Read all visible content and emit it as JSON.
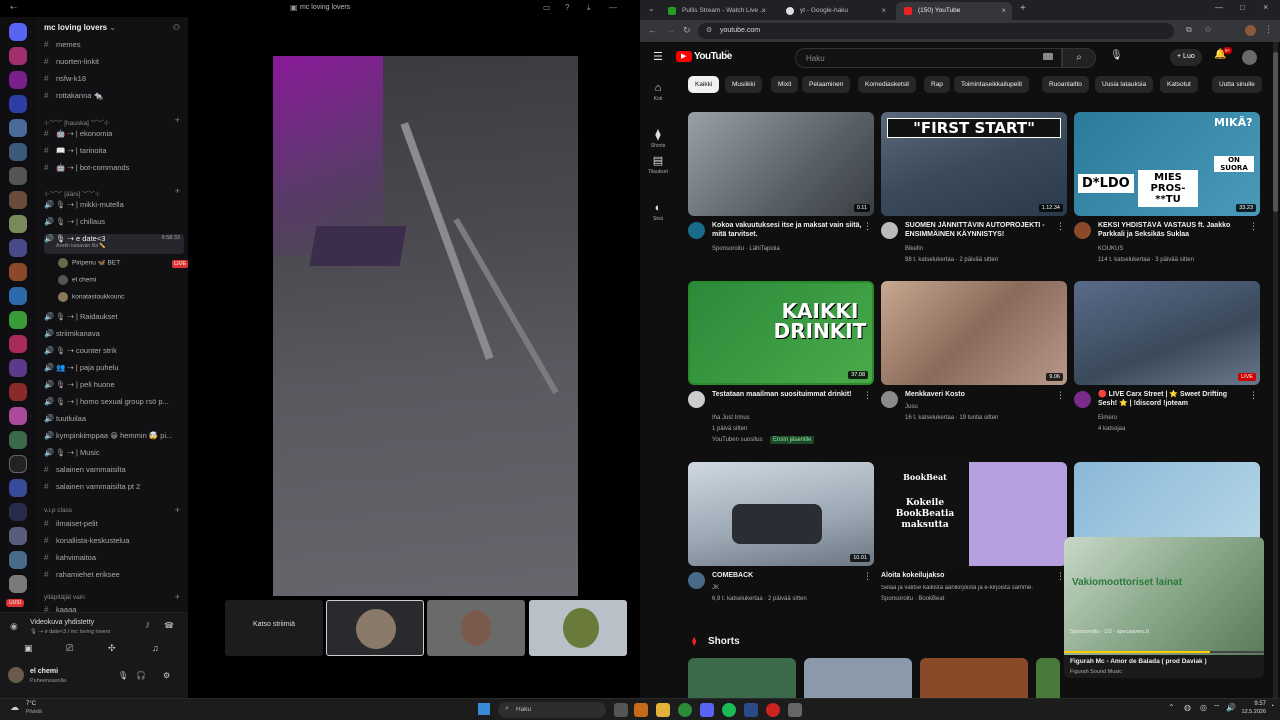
{
  "discord": {
    "window_title": "mc loving lovers",
    "server_name": "mc loving lovers",
    "channels_top": [
      "memes",
      "nuorten-linkit",
      "nsfw-k18",
      "rottakanna 🐀"
    ],
    "cat1": "⊹︶︶ [hauska] ︶︶⊹",
    "cat1_channels": [
      "🤖 ⇢ | ekonomia",
      "📖 ⇢ | tarinoita",
      "🤖 ⇢ | bot-commands"
    ],
    "cat2": "⊹︶︶ [ääni] ︶︶⊹",
    "voice1": [
      "🎙 ⇢ | mikki-mutella",
      "🎙 ⇢ | chillaus"
    ],
    "active_voice": "🎙 ⇢ e date<3",
    "active_voice_time": "6:58:33",
    "active_voice_sub": "Asetin kanavan tila ✏️",
    "users": [
      {
        "name": "Piripenu 🦋 BET",
        "live": "LIVE"
      },
      {
        "name": "el chemi",
        "live": ""
      },
      {
        "name": "konatastoukkounc",
        "live": ""
      }
    ],
    "voice2": [
      "🎙 ⇢ | Raidaukset",
      "striimikanava",
      "🎙 ⇢ counter strik",
      "👥 ⇢ | paja puhelu",
      "🎙 ⇢ | peli huone",
      "🎙 ⇢ | homo sexual group rsö p...",
      "tuutluilaa",
      "kympinkimppaa 😁 hemmin 🤯 pi...",
      "🎙 ⇢ | Music",
      "salainen vammaisilta",
      "salainen vammaisilta pt 2"
    ],
    "cat3": "v.i.p class",
    "cat3_channels": [
      "ilmaiset-pelit",
      "konallista-keskustelua",
      "kahvimaitoa",
      "rahamiehet eriksee"
    ],
    "cat4": "ylläpitäjät vain",
    "cat4_channels": [
      "kaaaa"
    ],
    "voice_connected": "Videokuva yhdistetty",
    "voice_connected_sub": "🎙 ⇢ e date<3 / mc loving lovers",
    "user_name": "el chemi",
    "user_status": "Puheensasolla",
    "stream_tile": "Katso striimiä",
    "uusi_badge": "UUSI"
  },
  "chrome": {
    "tabs": [
      "Pullis Stream - Watch Live ...",
      "yt - Google-haku",
      "(150) YouTube"
    ],
    "url": "youtube.com"
  },
  "youtube": {
    "logo": "YouTube",
    "logo_sup": "FI",
    "search_placeholder": "Haku",
    "create_label": "Luo",
    "notif_count": "9+",
    "nav": [
      "Koti",
      "Shorts",
      "Tilaukset",
      "Sinä"
    ],
    "chips": [
      "Kaikki",
      "Musiikki",
      "Mixit",
      "Pelaaminen",
      "Komediasketsit",
      "Rap",
      "Toimintaseikkailupelit",
      "Ruoanlaitto",
      "Uusia latauksia",
      "Katsotut",
      "Uutta sinulle"
    ],
    "videos": [
      {
        "title": "Kokoa vakuutuksesi itse ja maksat vain siitä, mitä tarvitset.",
        "channel": "Sponsoroitu · LähiTapiola",
        "meta": "",
        "duration": "0.11"
      },
      {
        "title": "SUOMEN JÄNNITTÄVIN AUTOPROJEKTI - ENSIMMÄINEN KÄYNNISTYS!",
        "channel": "Bikefin",
        "meta": "98 t. katselukertaa · 2 päivää sitten",
        "duration": "1.12.34",
        "thumb_text": "\"FIRST START\""
      },
      {
        "title": "KEKSI YHDISTÄVÄ VASTAUS ft. Jaakko Parkkali ja Seksikäs Suklaa",
        "channel": "KOUKUS",
        "meta": "114 t. katselukertaa · 3 päivää sitten",
        "duration": "33.23",
        "thumb_text": "D*LDO",
        "thumb_text2": "MIES PROS-**TU",
        "thumb_text3": "MIKÄ?",
        "thumb_text4": "ON SUORA"
      },
      {
        "title": "Testataan maailman suosituimmat drinkit!",
        "channel": "Iha Just Irmus",
        "meta": "1 päivä sitten",
        "duration": "37.08",
        "thumb_text": "KAIKKI DRINKIT",
        "extra": "YouTuben suositus",
        "extra2": "Ensin jäsenille"
      },
      {
        "title": "Menkkaveri Kosto",
        "channel": "Jusu",
        "meta": "16 t. katselukertaa · 19 tuntia sitten",
        "duration": "9.06"
      },
      {
        "title": "🔴 LIVE Carx Street | ⭐ Sweet Drifting Sesh! ⭐ | !discord !joteam",
        "channel": "Elmero",
        "meta": "4 katsojaa",
        "duration": "LIVE"
      },
      {
        "title": "COMEBACK",
        "channel": "JK",
        "meta": "6,9 t. katselukertaa · 2 päivää sitten",
        "duration": "10.01"
      },
      {
        "title": "Aloita kokeilujakso",
        "channel": "Sponsoroitu · BookBeat",
        "meta": "Selaa ja valitse kaikista äänikirjoista ja e-kirjoista samme.",
        "duration": "",
        "thumb_text": "BookBeat",
        "thumb_text2": "Kokeile BookBeatia maksutta"
      },
      {
        "title": "",
        "channel": "",
        "meta": "",
        "duration": ""
      }
    ],
    "shorts_label": "Shorts",
    "mini": {
      "title": "Figurah Mc - Amor de Balada ( prod Daviak )",
      "channel": "Figurah Sound Music",
      "ad": "Vakiomoottoriset lainat",
      "sponsor": "Sponsoroitu · 1/2 · specsavers.fi"
    }
  },
  "taskbar": {
    "weather": "7°C",
    "weather_sub": "Pilvistä",
    "search": "Haku",
    "time": "9.57",
    "date": "12.5.2026"
  }
}
